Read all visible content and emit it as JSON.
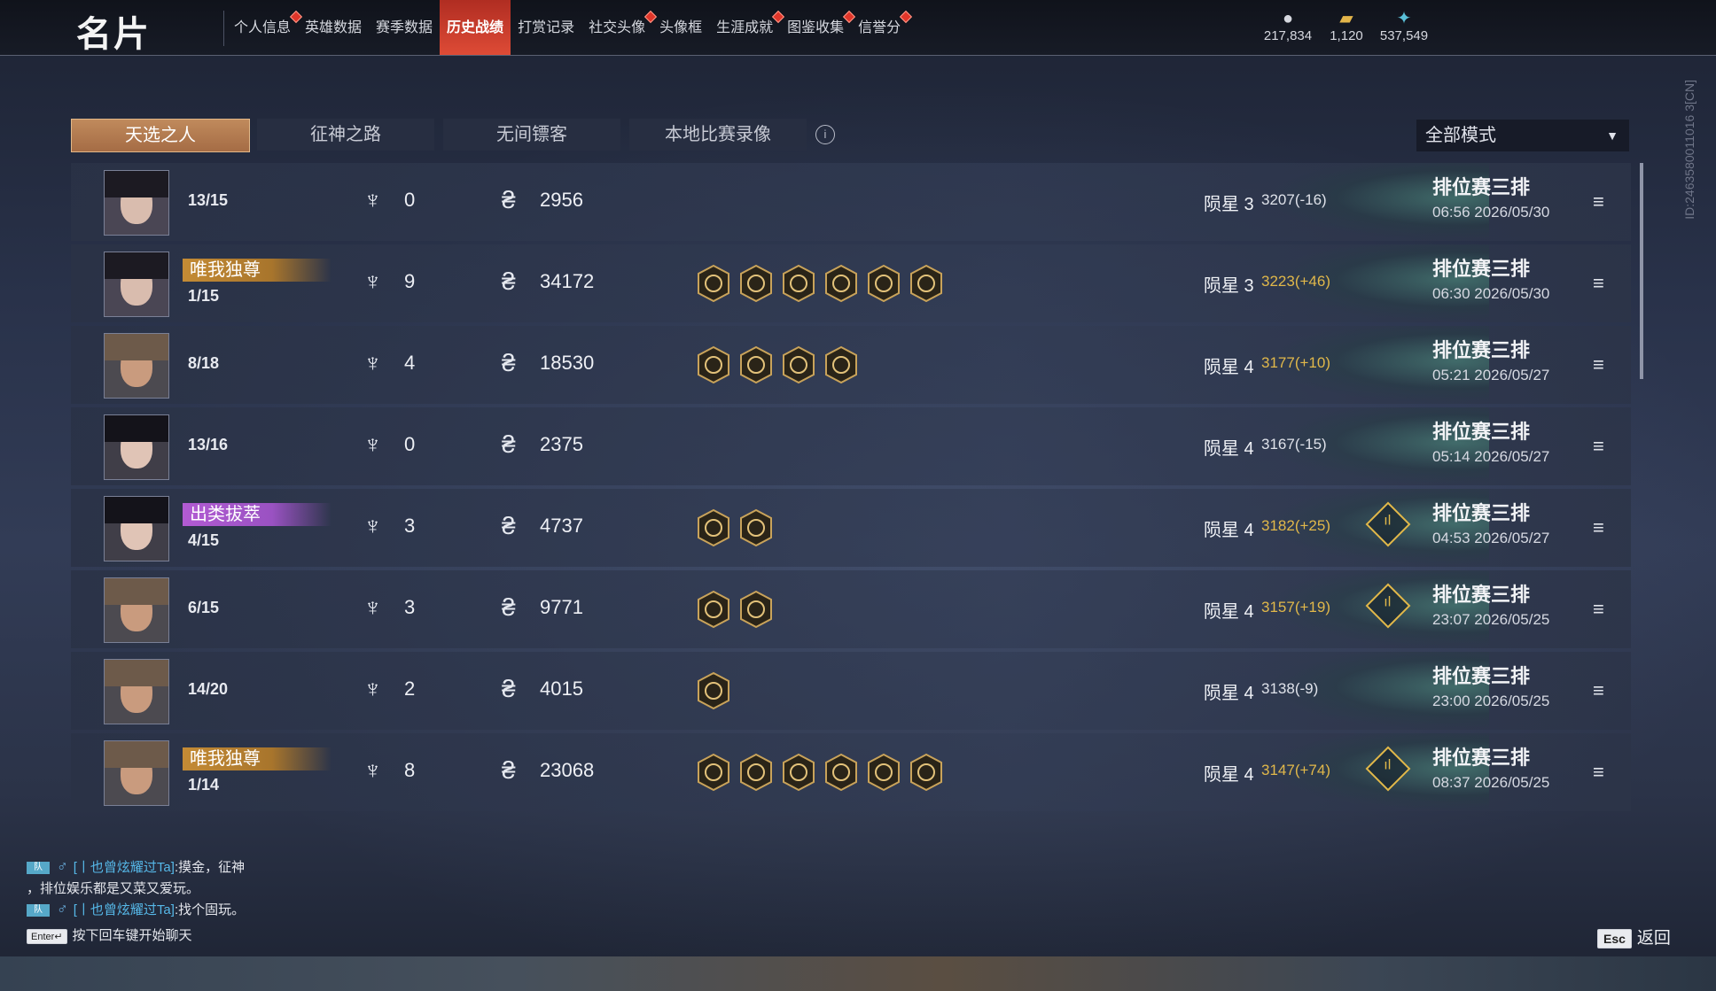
{
  "page_title": "名片",
  "nav_tabs": [
    {
      "label": "个人信息",
      "alert": true
    },
    {
      "label": "英雄数据",
      "alert": false
    },
    {
      "label": "赛季数据",
      "alert": false
    },
    {
      "label": "历史战绩",
      "alert": false,
      "active": true
    },
    {
      "label": "打赏记录",
      "alert": false
    },
    {
      "label": "社交头像",
      "alert": true
    },
    {
      "label": "头像框",
      "alert": false
    },
    {
      "label": "生涯成就",
      "alert": true
    },
    {
      "label": "图鉴收集",
      "alert": true
    },
    {
      "label": "信誉分",
      "alert": true
    }
  ],
  "currencies": [
    {
      "icon": "coin-icon",
      "value": "217,834"
    },
    {
      "icon": "gold-bar-icon",
      "value": "1,120"
    },
    {
      "icon": "feather-icon",
      "value": "537,549"
    }
  ],
  "sub_tabs": [
    {
      "label": "天选之人",
      "active": true
    },
    {
      "label": "征神之路",
      "active": false
    },
    {
      "label": "无间镖客",
      "active": false
    },
    {
      "label": "本地比赛录像",
      "active": false
    }
  ],
  "info_symbol": "i",
  "mode_filter": {
    "selected": "全部模式",
    "chevron": "▼"
  },
  "vertical_id": "ID:2463580011016 3[CN]",
  "kill_symbol": "♆",
  "damage_symbol": "₴",
  "stat_symbol": "ıl",
  "menu_symbol": "≡",
  "matches": [
    {
      "avatar": "female-eyepatch",
      "title": "",
      "title_style": "",
      "placement": "13/15",
      "kills": "0",
      "damage": "2956",
      "badges": [],
      "tier": "陨星 3",
      "score": "3207(-16)",
      "score_up": false,
      "stats": false,
      "mode": "排位赛三排",
      "time": "06:56  2026/05/30"
    },
    {
      "avatar": "female-eyepatch",
      "title": "唯我独尊",
      "title_style": "gold",
      "placement": "1/15",
      "kills": "9",
      "damage": "34172",
      "badges": [
        "demon-badge-icon",
        "swirl-badge-icon",
        "slash-badge-icon",
        "claw-badge-icon",
        "skull-badge-icon",
        "crossed-swords-badge-icon"
      ],
      "tier": "陨星 3",
      "score": "3223(+46)",
      "score_up": true,
      "stats": false,
      "mode": "排位赛三排",
      "time": "06:30  2026/05/30"
    },
    {
      "avatar": "bald-male",
      "title": "",
      "title_style": "",
      "placement": "8/18",
      "kills": "4",
      "damage": "18530",
      "badges": [
        "swirl-badge-icon",
        "skull-badge-icon",
        "crossed-swords-badge-icon",
        "helmet-badge-icon"
      ],
      "tier": "陨星 4",
      "score": "3177(+10)",
      "score_up": true,
      "stats": false,
      "mode": "排位赛三排",
      "time": "05:21  2026/05/27"
    },
    {
      "avatar": "female-dark-hair",
      "title": "",
      "title_style": "",
      "placement": "13/16",
      "kills": "0",
      "damage": "2375",
      "badges": [],
      "tier": "陨星 4",
      "score": "3167(-15)",
      "score_up": false,
      "stats": false,
      "mode": "排位赛三排",
      "time": "05:14  2026/05/27"
    },
    {
      "avatar": "female-dark-hair",
      "title": "出类拔萃",
      "title_style": "purple",
      "placement": "4/15",
      "kills": "3",
      "damage": "4737",
      "badges": [
        "dragon-badge-icon",
        "shield-badge-icon"
      ],
      "tier": "陨星 4",
      "score": "3182(+25)",
      "score_up": true,
      "stats": true,
      "mode": "排位赛三排",
      "time": "04:53  2026/05/27"
    },
    {
      "avatar": "bald-male",
      "title": "",
      "title_style": "",
      "placement": "6/15",
      "kills": "3",
      "damage": "9771",
      "badges": [
        "skull-badge-icon",
        "crossed-swords-badge-icon"
      ],
      "tier": "陨星 4",
      "score": "3157(+19)",
      "score_up": true,
      "stats": true,
      "mode": "排位赛三排",
      "time": "23:07  2026/05/25"
    },
    {
      "avatar": "bald-male",
      "title": "",
      "title_style": "",
      "placement": "14/20",
      "kills": "2",
      "damage": "4015",
      "badges": [
        "crossed-swords-badge-icon"
      ],
      "tier": "陨星 4",
      "score": "3138(-9)",
      "score_up": false,
      "stats": false,
      "mode": "排位赛三排",
      "time": "23:00  2026/05/25"
    },
    {
      "avatar": "bald-male",
      "title": "唯我独尊",
      "title_style": "gold",
      "placement": "1/14",
      "kills": "8",
      "damage": "23068",
      "badges": [
        "demon-badge-icon",
        "swirl-badge-icon",
        "tower-badge-icon",
        "dragon-badge-icon",
        "skull-badge-icon",
        "crossed-swords-badge-icon"
      ],
      "tier": "陨星 4",
      "score": "3147(+74)",
      "score_up": true,
      "stats": true,
      "mode": "排位赛三排",
      "time": "08:37  2026/05/25"
    }
  ],
  "chat": {
    "messages": [
      {
        "tag": "队",
        "gender": "♂",
        "speaker": "[丨也曾炫耀过Ta]",
        "text": ":摸金，征神"
      },
      {
        "tag": "队",
        "gender": "♂",
        "speaker": "[丨也曾炫耀过Ta]",
        "text": ":找个固玩。"
      }
    ],
    "continuation": "，排位娱乐都是又菜又爱玩。",
    "enter_key": "Enter↵",
    "enter_hint": "按下回车键开始聊天"
  },
  "esc_key": "Esc",
  "back_label": "返回",
  "colors": {
    "accent_red": "#de4b36",
    "tab_active": "#b47a4f",
    "score_gain": "#e1b84a",
    "chat_name": "#56b8e8"
  }
}
